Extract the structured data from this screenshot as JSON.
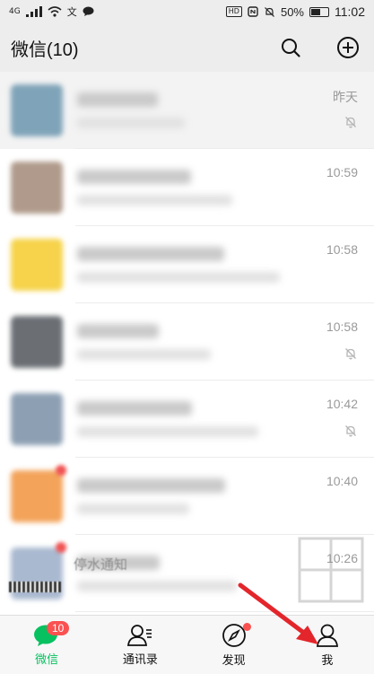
{
  "status_bar": {
    "network": "4G",
    "hd": "HD",
    "battery": "50%",
    "time": "11:02"
  },
  "header": {
    "title": "微信(10)",
    "search_icon": "search-icon",
    "add_icon": "plus-circle-icon"
  },
  "chats": [
    {
      "time": "昨天",
      "muted": true,
      "pinned": true,
      "avatar_color": "#7fa3b8"
    },
    {
      "time": "10:59",
      "muted": false,
      "pinned": false,
      "avatar_color": "#b09a8b"
    },
    {
      "time": "10:58",
      "muted": false,
      "pinned": false,
      "avatar_color": "#f6d34a"
    },
    {
      "time": "10:58",
      "muted": true,
      "pinned": false,
      "avatar_color": "#6b6f74"
    },
    {
      "time": "10:42",
      "muted": true,
      "pinned": false,
      "avatar_color": "#8da0b3"
    },
    {
      "time": "10:40",
      "muted": false,
      "pinned": false,
      "avatar_color": "#f3a35a"
    },
    {
      "time": "10:26",
      "muted": false,
      "pinned": false,
      "avatar_color": "#a9b9d0"
    }
  ],
  "partial_preview": "停水通知",
  "tabs": [
    {
      "label": "微信",
      "icon": "chat-bubble-icon",
      "badge": "10",
      "active": true
    },
    {
      "label": "通讯录",
      "icon": "contacts-icon",
      "active": false
    },
    {
      "label": "发现",
      "icon": "compass-icon",
      "dot": true,
      "active": false
    },
    {
      "label": "我",
      "icon": "person-icon",
      "active": false
    }
  ],
  "colors": {
    "accent": "#07c160",
    "badge": "#fa5151",
    "arrow": "#e3262b"
  }
}
